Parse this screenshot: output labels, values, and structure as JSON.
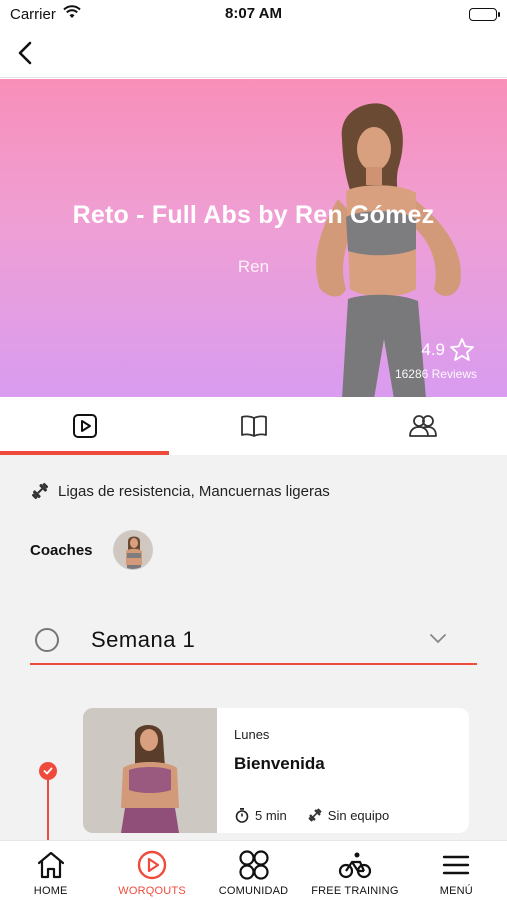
{
  "status_bar": {
    "carrier": "Carrier",
    "time": "8:07 AM"
  },
  "hero": {
    "title": "Reto - Full Abs by Ren Gómez",
    "author": "Ren",
    "rating": "4.9",
    "reviews": "16286 Reviews"
  },
  "tabs": [
    {
      "icon": "play-icon",
      "active": true
    },
    {
      "icon": "book-icon",
      "active": false
    },
    {
      "icon": "community-icon",
      "active": false
    }
  ],
  "details": {
    "equipment": "Ligas de resistencia, Mancuernas ligeras",
    "coaches_label": "Coaches"
  },
  "week": {
    "label": "Semana  1"
  },
  "workout": {
    "day": "Lunes",
    "title": "Bienvenida",
    "duration": "5 min",
    "equipment": "Sin equipo"
  },
  "bottom_nav": [
    {
      "label": "HOME",
      "icon": "home-icon",
      "active": false
    },
    {
      "label": "WORQOUTS",
      "icon": "play-circle-icon",
      "active": true
    },
    {
      "label": "COMUNIDAD",
      "icon": "circles-icon",
      "active": false
    },
    {
      "label": "FREE TRAINING",
      "icon": "bicycle-icon",
      "active": false
    },
    {
      "label": "MENÚ",
      "icon": "menu-icon",
      "active": false
    }
  ],
  "colors": {
    "accent": "#ef4b3c",
    "hero_top": "#f88fb9",
    "hero_bottom": "#d99cf0"
  }
}
